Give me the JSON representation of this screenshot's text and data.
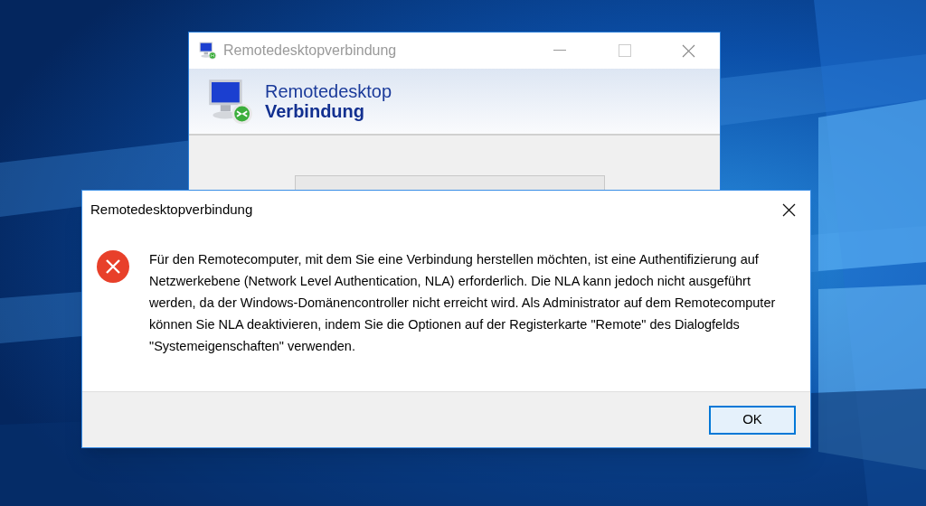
{
  "background_window": {
    "title": "Remotedesktopverbindung",
    "banner": {
      "line_1": "Remotedesktop",
      "line_2": "Verbindung"
    }
  },
  "dialog": {
    "title": "Remotedesktopverbindung",
    "message": "Für den Remotecomputer, mit dem Sie eine Verbindung herstellen möchten, ist eine Authentifizierung auf Netzwerkebene (Network Level Authentication, NLA) erforderlich. Die NLA kann jedoch nicht ausgeführt werden, da der Windows-Domänencontroller nicht erreicht wird. Als Administrator auf dem Remotecomputer können Sie NLA deaktivieren, indem Sie die Optionen auf der Registerkarte \"Remote\" des Dialogfelds \"Systemeigenschaften\" verwenden.",
    "buttons": [
      {
        "label": "OK",
        "selected": true
      }
    ]
  }
}
